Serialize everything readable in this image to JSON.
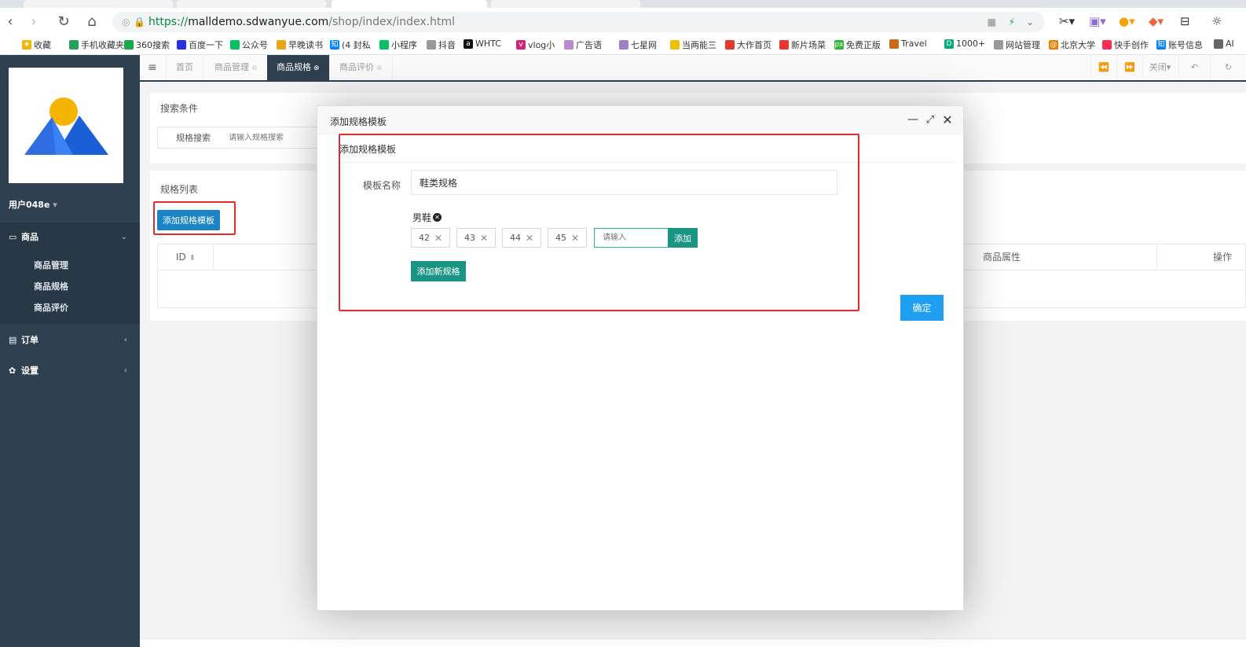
{
  "browser": {
    "url_scheme": "https://",
    "url_host": "malldemo.sdwanyue.com",
    "url_path": "/shop/index/index.html",
    "bookmarks": [
      "收藏",
      "手机收藏夹",
      "360搜索",
      "百度一下",
      "公众号",
      "早晚读书",
      "(4 封私",
      "小程序",
      "抖音",
      "WHTC",
      "vlog小",
      "广告语",
      "七星网",
      "当两能三",
      "大作首页",
      "新片场菜",
      "免费正版",
      "Travel",
      "1000+",
      "网站管理",
      "北京大学",
      "快手创作",
      "账号信息",
      "AI"
    ]
  },
  "sidebar": {
    "user": "用户048e",
    "menu": {
      "goods": "商品",
      "goods_items": [
        "商品管理",
        "商品规格",
        "商品评价"
      ],
      "orders": "订单",
      "settings": "设置"
    }
  },
  "tabs": {
    "home": "首页",
    "items": [
      "商品管理",
      "商品规格",
      "商品评价"
    ],
    "close_label": "关闭"
  },
  "search": {
    "title": "搜索条件",
    "label": "规格搜索",
    "placeholder": "请输入规格搜索"
  },
  "list": {
    "title": "规格列表",
    "add_button": "添加规格模板",
    "columns": [
      "ID",
      "商品属性",
      "操作"
    ]
  },
  "modal": {
    "title": "添加规格模板",
    "inner_title": "添加规格模板",
    "name_label": "模板名称",
    "name_value": "鞋类规格",
    "spec_name": "男鞋",
    "values": [
      "42",
      "43",
      "44",
      "45"
    ],
    "value_placeholder": "请输入",
    "value_add": "添加",
    "add_spec": "添加新规格",
    "confirm": "确定"
  },
  "colors": {
    "sidebar": "#2f4050",
    "primary_blue": "#1c84c6",
    "teal": "#1a9584",
    "confirm_blue": "#1e9ff2",
    "highlight_red": "#e52b2b"
  }
}
